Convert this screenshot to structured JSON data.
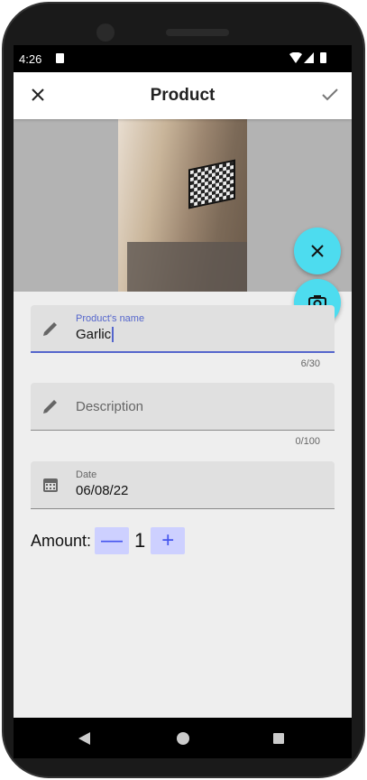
{
  "status": {
    "time": "4:26"
  },
  "appbar": {
    "title": "Product"
  },
  "form": {
    "name": {
      "label": "Product's name",
      "value": "Garlic",
      "counter": "6/30"
    },
    "description": {
      "placeholder": "Description",
      "counter": "0/100"
    },
    "date": {
      "label": "Date",
      "value": "06/08/22"
    },
    "amount": {
      "label": "Amount:",
      "value": "1",
      "minus": "—",
      "plus": "+"
    }
  },
  "colors": {
    "accent": "#5566cc",
    "fab": "#4ddcef"
  }
}
